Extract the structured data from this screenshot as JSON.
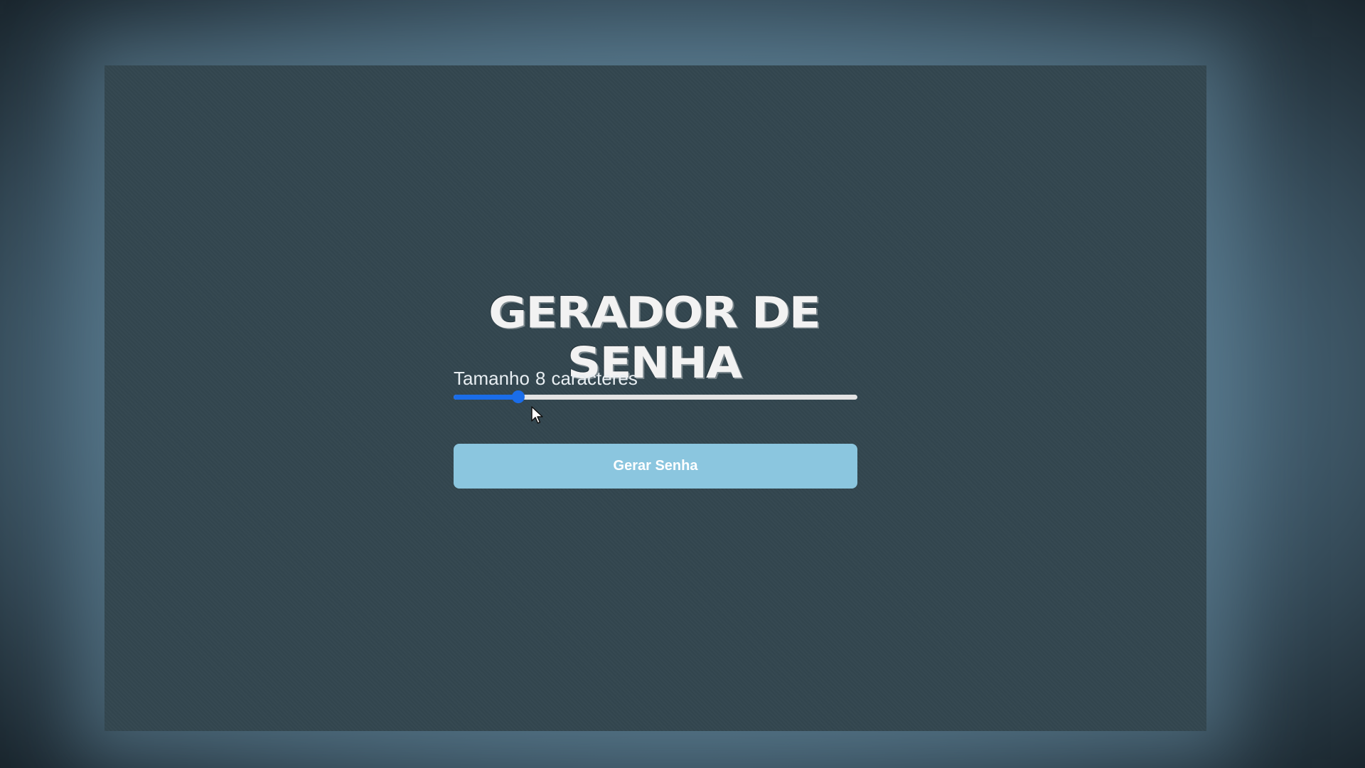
{
  "app": {
    "title": "GERADOR DE SENHA"
  },
  "length": {
    "prefix": "Tamanho",
    "value": "8",
    "suffix": "caracteres",
    "slider_level_percent": 16
  },
  "actions": {
    "generate_label": "Gerar Senha"
  },
  "colors": {
    "panel": "#33464f",
    "accent": "#1a6dea",
    "button": "#8bc6df",
    "text": "#e8eef2"
  },
  "icons": {
    "cursor": "mouse-pointer-icon"
  }
}
